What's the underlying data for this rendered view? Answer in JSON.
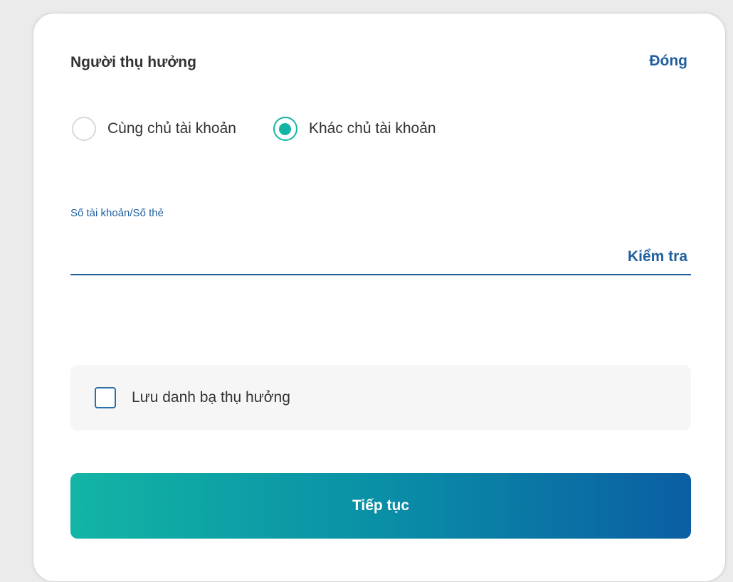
{
  "header": {
    "title": "Người thụ hưởng",
    "close_label": "Đóng"
  },
  "recipient_type": {
    "options": [
      {
        "label": "Cùng chủ tài khoản",
        "selected": false
      },
      {
        "label": "Khác chủ tài khoản",
        "selected": true
      }
    ]
  },
  "account_field": {
    "label": "Số tài khoản/Số thẻ",
    "value": "",
    "check_label": "Kiểm tra"
  },
  "save_contact": {
    "label": "Lưu danh bạ thụ hưởng",
    "checked": false
  },
  "continue_button": {
    "label": "Tiếp tục"
  },
  "colors": {
    "accent_blue": "#1e5f9e",
    "accent_teal": "#12b5a5",
    "gradient_end": "#0b5ea4"
  }
}
